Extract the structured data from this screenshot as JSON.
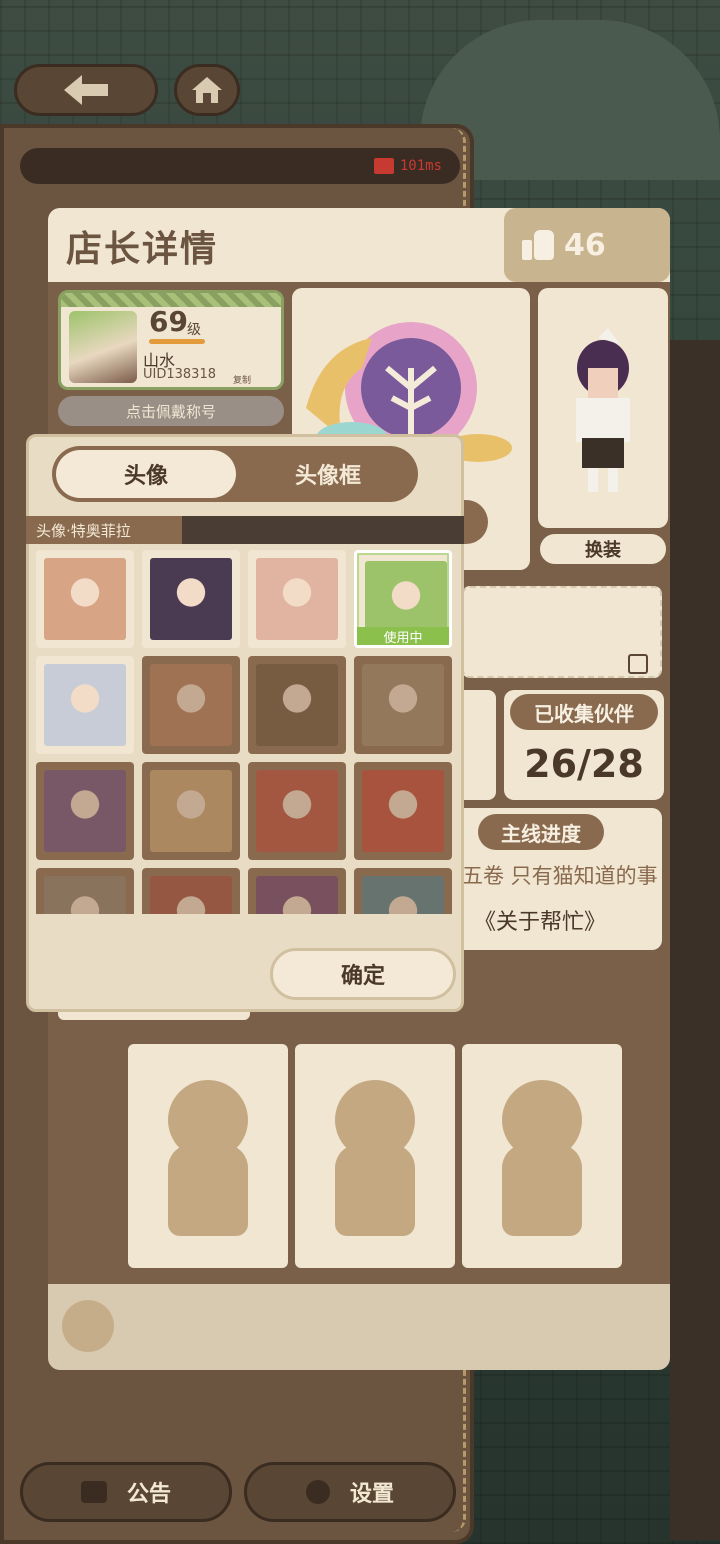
{
  "status": {
    "ping": "101ms"
  },
  "detail": {
    "title": "店长详情",
    "likes": "46",
    "profile": {
      "level": "69",
      "level_unit": "级",
      "name": "山水",
      "uid": "UID138318",
      "copy": "复制"
    },
    "wear_title": "点击佩戴称号",
    "dress_button": "换装",
    "collect": {
      "label": "已收集伙伴",
      "value": "26/28"
    },
    "story": {
      "label": "主线进度",
      "chapter": "五卷 只有猫知道的事",
      "subtitle": "《关于帮忙》"
    }
  },
  "dialog": {
    "tabs": [
      {
        "label": "头像",
        "selected": true
      },
      {
        "label": "头像框",
        "selected": false
      }
    ],
    "current_name": "头像·特奥菲拉",
    "in_use_label": "使用中",
    "confirm": "确定",
    "avatars": [
      {
        "owned": true,
        "color": "#d8a486"
      },
      {
        "owned": true,
        "color": "#4a3a52"
      },
      {
        "owned": true,
        "color": "#e0b4a0"
      },
      {
        "owned": true,
        "color": "#9dc36a",
        "in_use": true
      },
      {
        "owned": true,
        "color": "#c8ccd6"
      },
      {
        "owned": false,
        "color": "#b07858"
      },
      {
        "owned": false,
        "color": "#6a5038"
      },
      {
        "owned": false,
        "color": "#9a8468"
      },
      {
        "owned": false,
        "color": "#6a4a7a"
      },
      {
        "owned": false,
        "color": "#c8a070"
      },
      {
        "owned": false,
        "color": "#b84838"
      },
      {
        "owned": false,
        "color": "#c04030"
      },
      {
        "owned": false,
        "color": "#8a7a68"
      },
      {
        "owned": false,
        "color": "#a04838"
      },
      {
        "owned": false,
        "color": "#6a3a6a"
      },
      {
        "owned": false,
        "color": "#4a7a8a"
      }
    ]
  },
  "bottom": {
    "notice": "公告",
    "settings": "设置"
  },
  "colors": {
    "accent": "#8a6a4e",
    "in_use": "#8cc04c",
    "ping": "#c73a32"
  }
}
